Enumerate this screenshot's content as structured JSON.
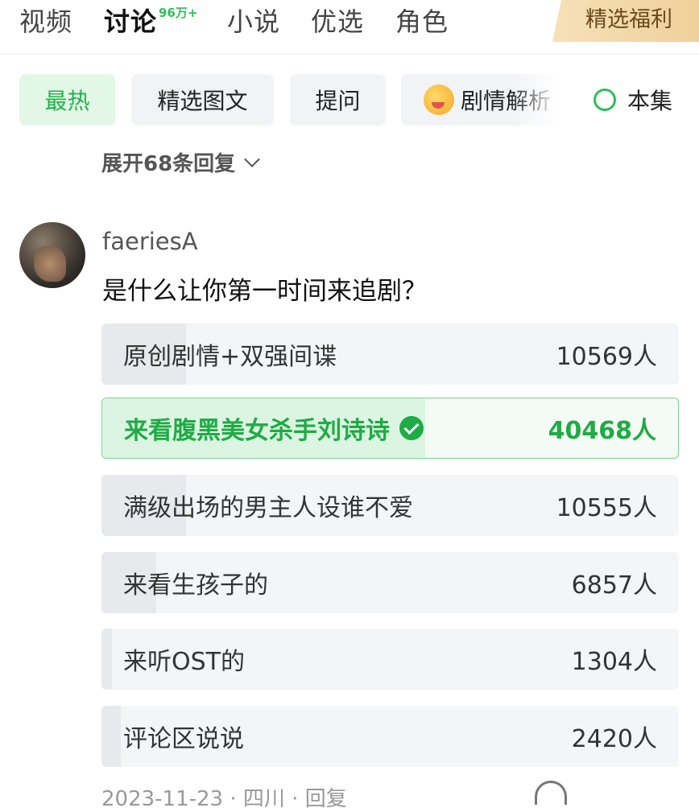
{
  "top_tabs": [
    {
      "label": "视频",
      "active": false
    },
    {
      "label": "讨论",
      "active": true
    },
    {
      "label": "小说",
      "active": false
    },
    {
      "label": "优选",
      "active": false
    },
    {
      "label": "角色",
      "active": false
    }
  ],
  "discussion_badge": "96万+",
  "welfare_button": "精选福利",
  "filter_chips": [
    {
      "label": "最热",
      "active": true
    },
    {
      "label": "精选图文",
      "active": false
    },
    {
      "label": "提问",
      "active": false
    },
    {
      "label": "剧情解析",
      "active": false,
      "icon": "laughing-face-icon"
    }
  ],
  "episode_filter": {
    "label": "本集",
    "checked": false
  },
  "expand_replies": "展开68条回复",
  "comment": {
    "username": "faeriesA",
    "text": "是什么让你第一时间来追剧？",
    "poll": [
      {
        "label": "原创剧情+双强间谍",
        "count": "10569人",
        "votes": 10569,
        "selected": false
      },
      {
        "label": "来看腹黑美女杀手刘诗诗",
        "count": "40468人",
        "votes": 40468,
        "selected": true
      },
      {
        "label": "满级出场的男主人设谁不爱",
        "count": "10555人",
        "votes": 10555,
        "selected": false
      },
      {
        "label": "来看生孩子的",
        "count": "6857人",
        "votes": 6857,
        "selected": false
      },
      {
        "label": "来听OST的",
        "count": "1304人",
        "votes": 1304,
        "selected": false
      },
      {
        "label": "评论区说说",
        "count": "2420人",
        "votes": 2420,
        "selected": false
      }
    ],
    "meta": "2023-11-23 · 四川 · 回复"
  },
  "colors": {
    "accent": "#2fbf5a",
    "selected_text": "#1fab45"
  }
}
